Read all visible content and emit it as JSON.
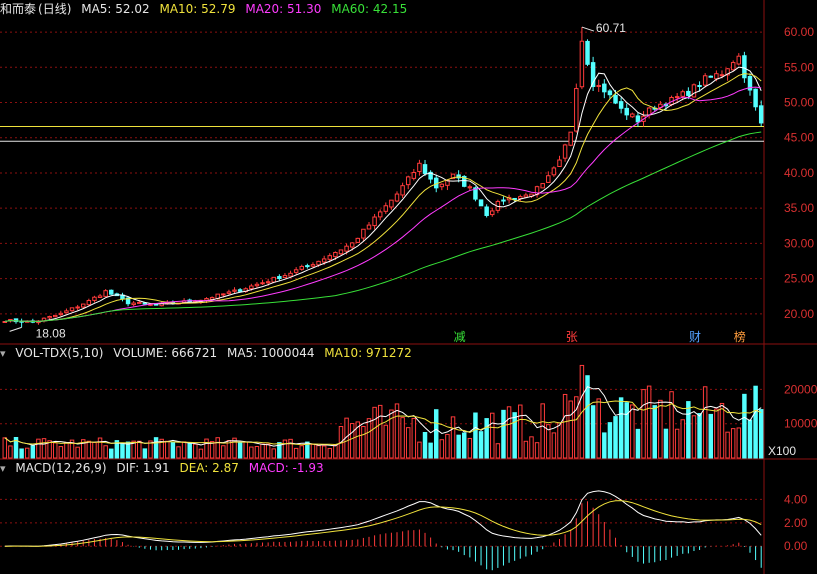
{
  "header": {
    "stock_name": "和而泰",
    "period": "(日线)",
    "ma5": "MA5: 52.02",
    "ma10": "MA10: 52.79",
    "ma20": "MA20: 51.30",
    "ma60": "MA60: 42.15"
  },
  "volume_header": {
    "indicator": "VOL-TDX(5,10)",
    "volume": "VOLUME: 666721",
    "ma5": "MA5: 1000044",
    "ma10": "MA10: 971272"
  },
  "macd_header": {
    "indicator": "MACD(12,26,9)",
    "dif": "DIF: 1.91",
    "dea": "DEA: 2.87",
    "macd": "MACD: -1.93"
  },
  "colors": {
    "up": "#ff3b3b",
    "down": "#54ffff",
    "ma5": "#ffffff",
    "ma10": "#f0e23c",
    "ma20": "#ff3cff",
    "ma60": "#38e038",
    "grid": "#8b1010",
    "axis_text": "#d83030"
  },
  "chart_data": [
    {
      "type": "candlestick",
      "yaxis_side": "right",
      "ylim": [
        16,
        62
      ],
      "ytick_labels": [
        "20.00",
        "25.00",
        "30.00",
        "35.00",
        "40.00",
        "45.00",
        "50.00",
        "55.00",
        "60.00"
      ],
      "yticks": [
        20,
        25,
        30,
        35,
        40,
        45,
        50,
        55,
        60
      ],
      "annotations": [
        {
          "text": "60.71",
          "role": "high_marker",
          "index": 103,
          "value": 60.71
        },
        {
          "text": "18.08",
          "role": "low_marker",
          "index": 3,
          "value": 18.08
        }
      ],
      "event_labels": [
        {
          "text": "减",
          "index": 81,
          "color": "#38e038"
        },
        {
          "text": "张",
          "index": 101,
          "color": "#ff3b3b"
        },
        {
          "text": "财",
          "index": 123,
          "color": "#54a0ff"
        },
        {
          "text": "榜",
          "index": 131,
          "color": "#ff9c3c"
        }
      ],
      "hlines": [
        {
          "value": 46.6,
          "color": "#f0e23c"
        },
        {
          "value": 44.5,
          "color": "#e6e6e6"
        }
      ],
      "series_count": 136
    },
    {
      "type": "bar",
      "ylim": [
        0,
        28000
      ],
      "ytick_labels": [
        "10000",
        "20000"
      ],
      "yticks": [
        10000,
        20000
      ],
      "unit_label": "X100"
    },
    {
      "type": "macd",
      "ylim": [
        -2.2,
        6.0
      ],
      "ytick_labels": [
        "0.00",
        "2.00",
        "4.00"
      ],
      "yticks": [
        0,
        2,
        4
      ]
    }
  ]
}
